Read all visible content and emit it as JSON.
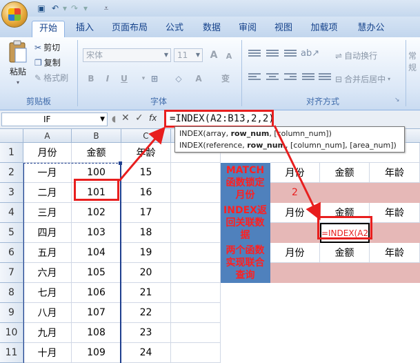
{
  "quick_access": {
    "save_icon": "save-icon",
    "undo_icon": "undo-icon",
    "redo_icon": "redo-icon"
  },
  "tabs": [
    "开始",
    "插入",
    "页面布局",
    "公式",
    "数据",
    "审阅",
    "视图",
    "加载项",
    "慧办公"
  ],
  "active_tab": "开始",
  "clipboard": {
    "paste": "粘贴",
    "cut": "剪切",
    "copy": "复制",
    "format_painter": "格式刷",
    "group_label": "剪贴板"
  },
  "font": {
    "font_name": "宋体",
    "font_size": "11",
    "grow": "A",
    "shrink": "A",
    "bold": "B",
    "italic": "I",
    "underline": "U",
    "font_color": "A",
    "phonetic": "变",
    "group_label": "字体"
  },
  "alignment": {
    "wrap_text": "自动换行",
    "merge_center": "合并后居中",
    "group_label": "对齐方式"
  },
  "number": {
    "format_value": "常规"
  },
  "formula_bar": {
    "name_box": "IF",
    "cancel": "✕",
    "enter": "✓",
    "fx": "fx",
    "formula": "=INDEX(A2:B13,2,2)"
  },
  "tooltip": {
    "line1_pre": "INDEX(array, ",
    "line1_bold": "row_num",
    "line1_post": ", [column_num])",
    "line2_pre": "INDEX(reference, ",
    "line2_bold": "row_num",
    "line2_post": ", [column_num], [area_num])"
  },
  "columns": [
    "A",
    "B",
    "C"
  ],
  "rows": [
    "1",
    "2",
    "3",
    "4",
    "5",
    "6",
    "7",
    "8",
    "9",
    "10",
    "11"
  ],
  "table": {
    "headers": [
      "月份",
      "金额",
      "年龄"
    ],
    "data": [
      [
        "一月",
        "100",
        "15"
      ],
      [
        "二月",
        "101",
        "16"
      ],
      [
        "三月",
        "102",
        "17"
      ],
      [
        "四月",
        "103",
        "18"
      ],
      [
        "五月",
        "104",
        "19"
      ],
      [
        "六月",
        "105",
        "20"
      ],
      [
        "七月",
        "106",
        "21"
      ],
      [
        "八月",
        "107",
        "22"
      ],
      [
        "九月",
        "108",
        "23"
      ],
      [
        "十月",
        "109",
        "24"
      ]
    ]
  },
  "side_table": {
    "labels": [
      "MATCH函数锁定月份",
      "INDEX返回关联数据",
      "两个函数实现联合查询"
    ],
    "headers": [
      "月份",
      "金额",
      "年龄"
    ],
    "match_result": "2",
    "editing_cell": "=INDEX(A2"
  },
  "colors": {
    "label_bg": "#4f81bd",
    "label_text": "#ff2020",
    "result_bg": "#e6b8b7",
    "annotation": "#e81e1e"
  }
}
